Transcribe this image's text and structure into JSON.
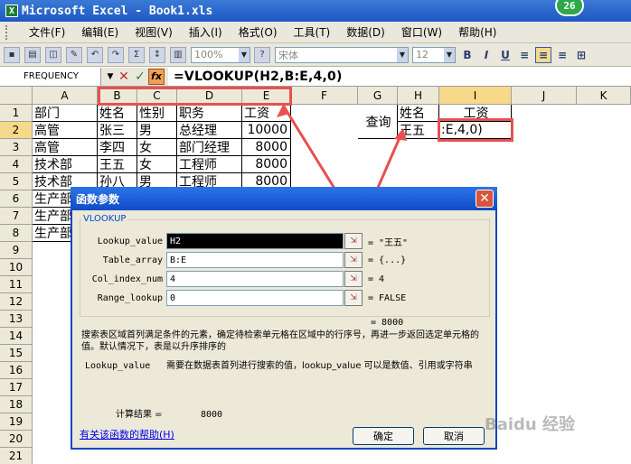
{
  "window": {
    "title": "Microsoft Excel - Book1.xls",
    "app_icon": "X",
    "badge": "26"
  },
  "menu": [
    "文件(F)",
    "编辑(E)",
    "视图(V)",
    "插入(I)",
    "格式(O)",
    "工具(T)",
    "数据(D)",
    "窗口(W)",
    "帮助(H)"
  ],
  "toolbar": {
    "zoom": "100%",
    "font": "宋体",
    "size": "12",
    "bold": "B",
    "italic": "I",
    "underline": "U"
  },
  "formula_bar": {
    "name_box": "FREQUENCY",
    "cancel": "✕",
    "enter": "✓",
    "fx": "fx",
    "formula": "=VLOOKUP(H2,B:E,4,0)"
  },
  "columns": [
    "A",
    "B",
    "C",
    "D",
    "E",
    "F",
    "G",
    "H",
    "I",
    "J",
    "K"
  ],
  "rows": [
    "1",
    "2",
    "3",
    "4",
    "5",
    "6",
    "7",
    "8",
    "9",
    "10",
    "11",
    "12",
    "13",
    "14",
    "15",
    "16",
    "17",
    "18",
    "19",
    "20",
    "21"
  ],
  "sheet": {
    "A1": "部门",
    "B1": "姓名",
    "C1": "性别",
    "D1": "职务",
    "E1": "工资",
    "A2": "高管",
    "B2": "张三",
    "C2": "男",
    "D2": "总经理",
    "E2": "10000",
    "A3": "高管",
    "B3": "李四",
    "C3": "女",
    "D3": "部门经理",
    "E3": "8000",
    "A4": "技术部",
    "B4": "王五",
    "C4": "女",
    "D4": "工程师",
    "E4": "8000",
    "A5": "技术部",
    "B5": "孙八",
    "C5": "男",
    "D5": "工程师",
    "E5": "8000",
    "A6": "生产部",
    "A7": "生产部",
    "A8": "生产部",
    "G2": "查询",
    "H1": "姓名",
    "H2": "王五",
    "I1": "工资",
    "I2": ":E,4,0)"
  },
  "dialog": {
    "title": "函数参数",
    "close": "✕",
    "function_name": "VLOOKUP",
    "args": [
      {
        "label": "Lookup_value",
        "value": "H2",
        "result": "= \"王五\""
      },
      {
        "label": "Table_array",
        "value": "B:E",
        "result": "= {...}"
      },
      {
        "label": "Col_index_num",
        "value": "4",
        "result": "= 4"
      },
      {
        "label": "Range_lookup",
        "value": "0",
        "result": "= FALSE"
      }
    ],
    "total_result": "= 8000",
    "description": "搜索表区域首列满足条件的元素，确定待检索单元格在区域中的行序号，再进一步返回选定单元格的值。默认情况下，表是以升序排序的",
    "param_name": "Lookup_value",
    "param_desc": "需要在数据表首列进行搜索的值，lookup_value 可以是数值、引用或字符串",
    "calc_label": "计算结果 =",
    "calc_value": "8000",
    "help_link": "有关该函数的帮助(H)",
    "ok": "确定",
    "cancel": "取消",
    "ref_btn": "⇲"
  },
  "watermark": "Baidu 经验"
}
